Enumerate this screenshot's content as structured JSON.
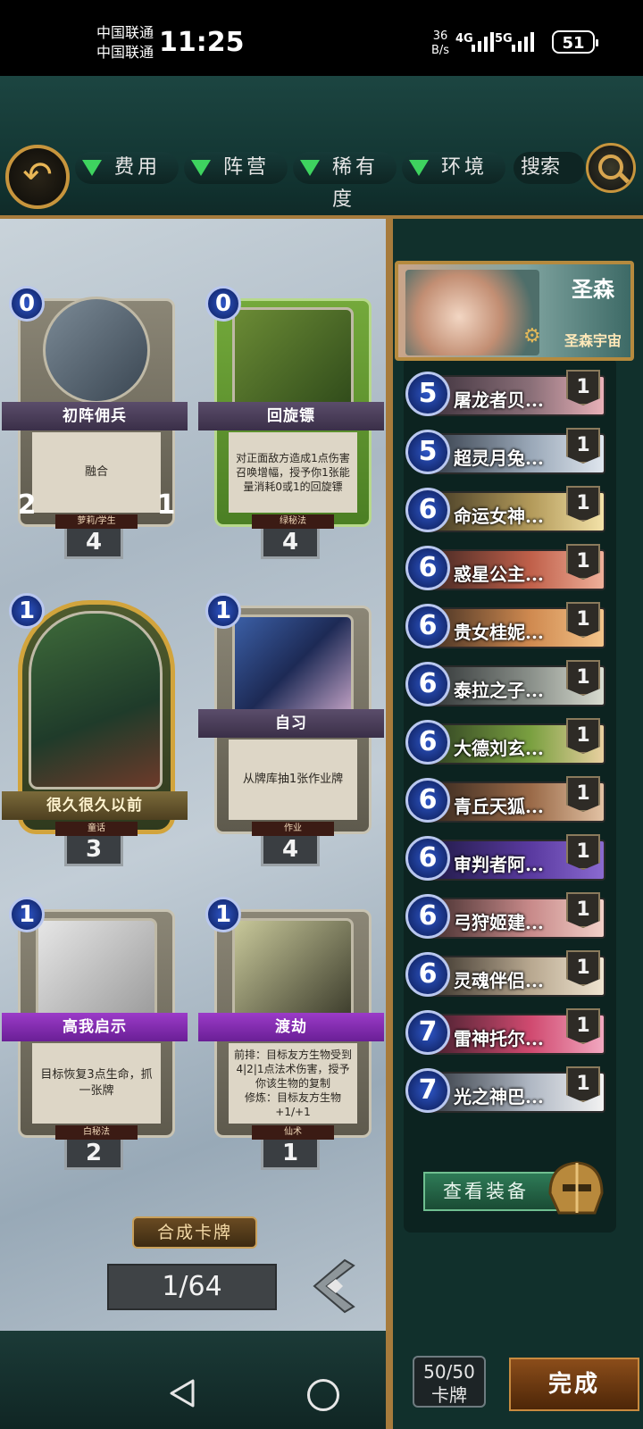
{
  "status_bar": {
    "carrier1": "中国联通",
    "carrier2": "中国联通",
    "time": "11:25",
    "net_speed_value": "36",
    "net_speed_unit": "B/s",
    "sig1": "4G",
    "sig2": "5G",
    "battery": "51"
  },
  "filters": {
    "cost": "费用",
    "faction": "阵营",
    "rarity": "稀有度",
    "environment": "环境",
    "search": "搜索"
  },
  "collection": {
    "cards": [
      {
        "cost": "0",
        "name": "初阵佣兵",
        "text": "融合",
        "type": "萝莉/学生",
        "count": "4",
        "attack": "2",
        "health": "1"
      },
      {
        "cost": "0",
        "name": "回旋镖",
        "text": "对正面敌方造成1点伤害\n召唤增幅，授予你1张能量消耗0或1的回旋镖",
        "type": "绿秘法",
        "count": "4"
      },
      {
        "cost": "1",
        "name": "很久很久以前",
        "text": "",
        "type": "童话",
        "count": "3"
      },
      {
        "cost": "1",
        "name": "自习",
        "text": "从牌库抽1张作业牌",
        "type": "作业",
        "count": "4"
      },
      {
        "cost": "1",
        "name": "高我启示",
        "text": "目标恢复3点生命，抓一张牌",
        "type": "白秘法",
        "count": "2"
      },
      {
        "cost": "1",
        "name": "渡劫",
        "text": "前排：目标友方生物受到4|2|1点法术伤害，授予你该生物的复制\n修炼：目标友方生物+1/+1",
        "type": "仙术",
        "count": "1"
      }
    ],
    "craft_button": "合成卡牌",
    "page_indicator": "1/64"
  },
  "deck": {
    "leader_name": "圣森",
    "leader_sub": "圣森宇宙",
    "cards": [
      {
        "cost": "5",
        "name": "屠龙者贝...",
        "count": "1"
      },
      {
        "cost": "5",
        "name": "超灵月兔...",
        "count": "1"
      },
      {
        "cost": "6",
        "name": "命运女神...",
        "count": "1"
      },
      {
        "cost": "6",
        "name": "惑星公主...",
        "count": "1"
      },
      {
        "cost": "6",
        "name": "贵女桂妮...",
        "count": "1"
      },
      {
        "cost": "6",
        "name": "泰拉之子...",
        "count": "1"
      },
      {
        "cost": "6",
        "name": "大德刘玄...",
        "count": "1"
      },
      {
        "cost": "6",
        "name": "青丘天狐...",
        "count": "1"
      },
      {
        "cost": "6",
        "name": "审判者阿...",
        "count": "1"
      },
      {
        "cost": "6",
        "name": "弓狩姬建...",
        "count": "1"
      },
      {
        "cost": "6",
        "name": "灵魂伴侣...",
        "count": "1"
      },
      {
        "cost": "7",
        "name": "雷神托尔...",
        "count": "1"
      },
      {
        "cost": "7",
        "name": "光之神巴...",
        "count": "1"
      }
    ],
    "equip_button": "查看装备",
    "deck_count": "50/50",
    "deck_count_label": "卡牌",
    "done_button": "完成"
  },
  "colors": {
    "accent_gold": "#c7953d",
    "filter_triangle": "#3ed35f",
    "mana_blue": "#2e56c7"
  }
}
